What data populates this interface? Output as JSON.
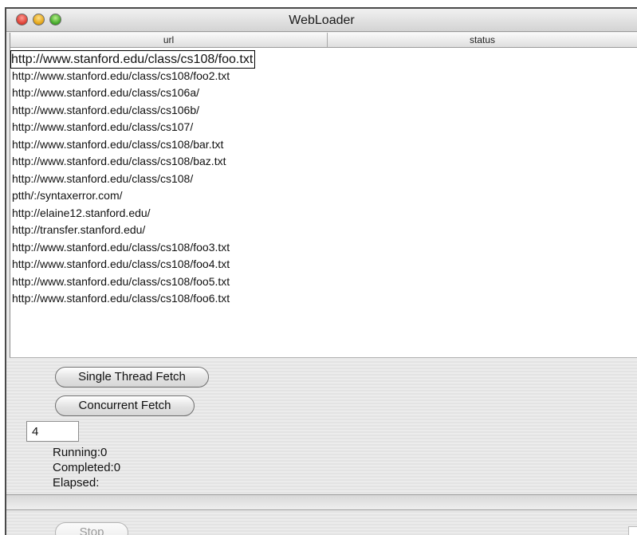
{
  "window": {
    "title": "WebLoader"
  },
  "table": {
    "columns": [
      "url",
      "status"
    ],
    "rows": [
      {
        "url": "http://www.stanford.edu/class/cs108/foo.txt",
        "status": "",
        "selected": true
      },
      {
        "url": "http://www.stanford.edu/class/cs108/foo2.txt",
        "status": ""
      },
      {
        "url": "http://www.stanford.edu/class/cs106a/",
        "status": ""
      },
      {
        "url": "http://www.stanford.edu/class/cs106b/",
        "status": ""
      },
      {
        "url": "http://www.stanford.edu/class/cs107/",
        "status": ""
      },
      {
        "url": "http://www.stanford.edu/class/cs108/bar.txt",
        "status": ""
      },
      {
        "url": "http://www.stanford.edu/class/cs108/baz.txt",
        "status": ""
      },
      {
        "url": "http://www.stanford.edu/class/cs108/",
        "status": ""
      },
      {
        "url": "ptth/:/syntaxerror.com/",
        "status": ""
      },
      {
        "url": "http://elaine12.stanford.edu/",
        "status": ""
      },
      {
        "url": "http://transfer.stanford.edu/",
        "status": ""
      },
      {
        "url": "http://www.stanford.edu/class/cs108/foo3.txt",
        "status": ""
      },
      {
        "url": "http://www.stanford.edu/class/cs108/foo4.txt",
        "status": ""
      },
      {
        "url": "http://www.stanford.edu/class/cs108/foo5.txt",
        "status": ""
      },
      {
        "url": "http://www.stanford.edu/class/cs108/foo6.txt",
        "status": ""
      }
    ]
  },
  "controls": {
    "single_thread_label": "Single Thread Fetch",
    "concurrent_label": "Concurrent Fetch",
    "thread_count": "4",
    "running": "Running:0",
    "completed": "Completed:0",
    "elapsed": "Elapsed:",
    "progress": 0,
    "stop_label": "Stop",
    "stop_enabled": false
  },
  "colors": {
    "progress_fill": "#5b8fd8"
  }
}
